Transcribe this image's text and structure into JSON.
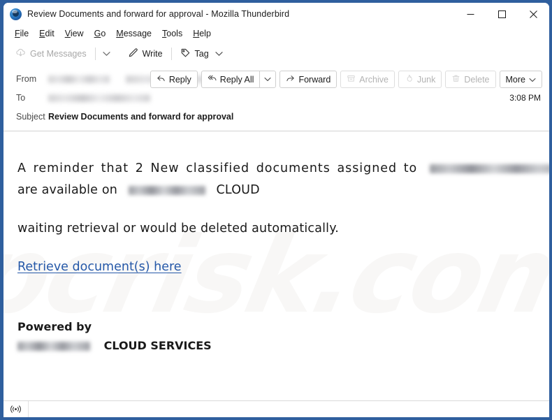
{
  "window": {
    "title": "Review Documents and forward for approval - Mozilla Thunderbird",
    "logo_icon": "thunderbird-logo-icon",
    "controls": {
      "minimize": "minimize-icon",
      "maximize": "maximize-icon",
      "close": "close-icon"
    }
  },
  "menubar": {
    "items": [
      {
        "label": "File",
        "accel": "F"
      },
      {
        "label": "Edit",
        "accel": "E"
      },
      {
        "label": "View",
        "accel": "V"
      },
      {
        "label": "Go",
        "accel": "G"
      },
      {
        "label": "Message",
        "accel": "M"
      },
      {
        "label": "Tools",
        "accel": "T"
      },
      {
        "label": "Help",
        "accel": "H"
      }
    ]
  },
  "toolbar": {
    "get_messages_label": "Get Messages",
    "get_messages_icon": "download-cloud-icon",
    "get_messages_caret_icon": "chevron-down-icon",
    "write_label": "Write",
    "write_icon": "pencil-icon",
    "tag_label": "Tag",
    "tag_icon": "tag-icon",
    "tag_caret_icon": "chevron-down-icon"
  },
  "header": {
    "from_label": "From",
    "from_value_redacted": true,
    "to_label": "To",
    "to_value_redacted": true,
    "subject_label": "Subject",
    "subject_value": "Review Documents and forward for approval",
    "time": "3:08 PM",
    "actions": [
      {
        "label": "Reply",
        "icon": "reply-arrow-icon",
        "enabled": true
      },
      {
        "label": "Reply All",
        "icon": "reply-all-arrow-icon",
        "enabled": true
      },
      {
        "label": "Forward",
        "icon": "forward-arrow-icon",
        "enabled": true
      },
      {
        "label": "Archive",
        "icon": "archive-box-icon",
        "enabled": false
      },
      {
        "label": "Junk",
        "icon": "junk-flame-icon",
        "enabled": false
      },
      {
        "label": "Delete",
        "icon": "trash-icon",
        "enabled": false
      },
      {
        "label": "More",
        "icon": "chevron-down-icon",
        "enabled": true
      }
    ],
    "reply_all_caret_icon": "chevron-down-icon"
  },
  "body": {
    "watermark_text": "pcrisk.com",
    "line1_part1": "A reminder that 2 New classified documents assigned to",
    "line1_redacted": true,
    "line2_part1": "are available on",
    "line2_redacted": true,
    "line2_part2": "CLOUD",
    "line3": "waiting retrieval or would be deleted automatically.",
    "link_text": "Retrieve document(s) here",
    "footer_line1": "Powered by",
    "footer_redacted": true,
    "footer_line2": "CLOUD SERVICES"
  },
  "statusbar": {
    "icon": "broadcast-signal-icon"
  },
  "colors": {
    "window_border": "#2f5f9e",
    "link": "#2558a8",
    "text": "#1a1a1a",
    "disabled_text": "#b3b3b3"
  }
}
